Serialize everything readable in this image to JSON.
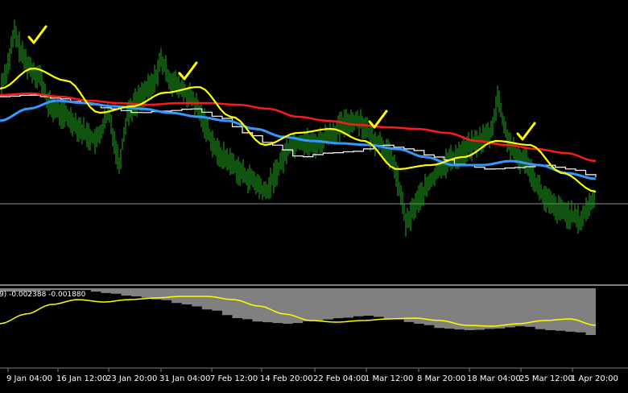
{
  "indicator_header": {
    "text": "9) -0.002388 -0.001880"
  },
  "time_axis": {
    "labels": [
      "9 Jan 04:00",
      "16 Jan 12:00",
      "23 Jan 20:00",
      "31 Jan 04:00",
      "7 Feb 12:00",
      "14 Feb 20:00",
      "22 Feb 04:00",
      "1 Mar 12:00",
      "8 Mar 20:00",
      "18 Mar 04:00",
      "25 Mar 12:00",
      "1 Apr 20:00"
    ]
  },
  "colors": {
    "background": "#000000",
    "candles": "#1fa81f",
    "ma_yellow": "#ffff00",
    "ma_red": "#ff0000",
    "ma_blue": "#3399ff",
    "ma_white": "#ffffff",
    "histogram": "#808080",
    "signal": "#ffff00",
    "checkmark": "#ffff00",
    "separator": "#808080"
  },
  "annotations": {
    "checkmark_icon": "check-icon",
    "count": 5
  },
  "chart_data": {
    "type": "line",
    "x": [
      "9 Jan 04:00",
      "16 Jan 12:00",
      "23 Jan 20:00",
      "31 Jan 04:00",
      "7 Feb 12:00",
      "14 Feb 20:00",
      "22 Feb 04:00",
      "1 Mar 12:00",
      "8 Mar 20:00",
      "18 Mar 04:00",
      "25 Mar 12:00",
      "1 Apr 20:00"
    ],
    "series": [
      {
        "values": [
          75,
          120,
          135,
          112,
          150,
          190,
          175,
          160,
          205,
          185,
          180,
          240
        ]
      },
      {
        "values": [
          118,
          120,
          128,
          130,
          128,
          145,
          155,
          158,
          168,
          180,
          178,
          200
        ]
      },
      {
        "values": [
          140,
          125,
          125,
          130,
          140,
          160,
          170,
          175,
          195,
          205,
          195,
          225
        ]
      },
      {
        "values": [
          120,
          122,
          135,
          135,
          140,
          175,
          190,
          180,
          205,
          200,
          205,
          220
        ]
      }
    ],
    "histogram": [
      365,
      362,
      360,
      358,
      360,
      368,
      390,
      400,
      405,
      410,
      408,
      418
    ],
    "signal": [
      400,
      372,
      378,
      370,
      368,
      380,
      395,
      395,
      400,
      405,
      398,
      405
    ]
  }
}
